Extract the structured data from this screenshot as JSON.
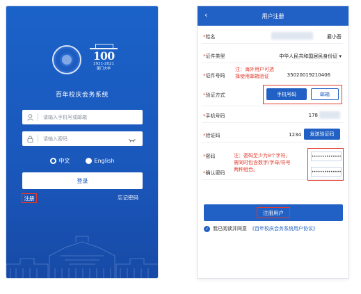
{
  "login": {
    "logo_number": "100",
    "logo_years": "1921-2021",
    "logo_subtitle": "厦门大学",
    "app_title": "百年校庆会务系统",
    "account_placeholder": "请输入手机号或邮箱",
    "password_placeholder": "请输入密码",
    "lang_chinese": "中文",
    "lang_english": "English",
    "login_button": "登录",
    "register_link": "注册",
    "forgot_link": "忘记密码"
  },
  "register": {
    "title": "用户注册",
    "back_icon": "chevron-left-icon",
    "name_label": "姓名",
    "name_value": "雇小吾",
    "id_type_label": "证件类型",
    "id_type_value": "中华人民共和国居民身份证",
    "id_number_label": "证件号码",
    "id_number_value": "35020019210406",
    "overseas_note_line1": "注：海外用户可选",
    "overseas_note_line2": "择使用邮箱验证",
    "verify_label": "验证方式",
    "verify_phone": "手机号码",
    "verify_email": "邮箱",
    "phone_label": "手机号码",
    "phone_value": "178",
    "code_label": "验证码",
    "code_value": "1234",
    "code_button": "发送验证码",
    "password_label": "密码",
    "confirm_label": "确认密码",
    "password_note_line1": "注：密码至少为8个字符，",
    "password_note_line2": "需同时包含数字/字母/符号",
    "password_note_line3": "两种组合。",
    "password_value": "••••••••••••••",
    "confirm_value": "••••••••••••••",
    "submit_button": "注册用户",
    "agree_text": "我已阅读并同意",
    "agree_link": "《百年校庆会务系统用户协议》"
  },
  "colors": {
    "primary": "#2160c4",
    "highlight": "#e23a2c"
  }
}
